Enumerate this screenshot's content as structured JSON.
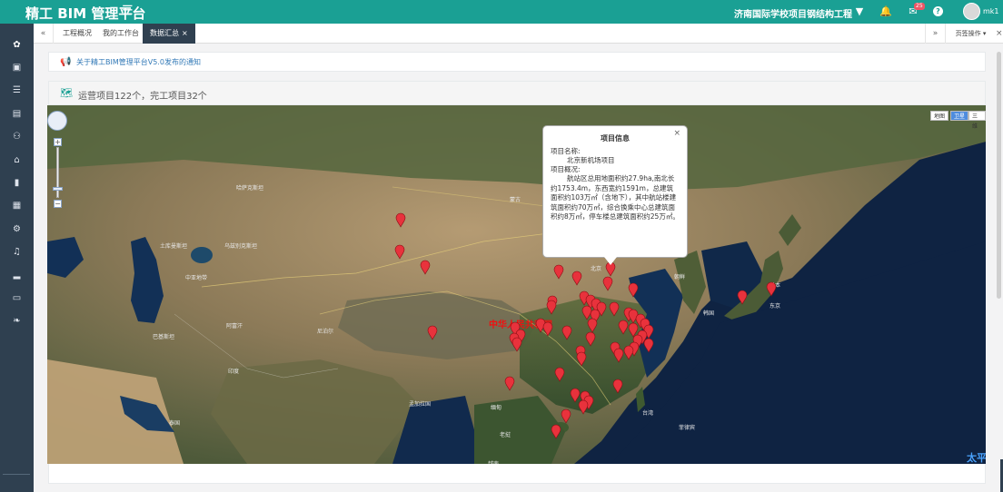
{
  "header": {
    "brand": "精工 BIM 管理平台",
    "menu_icon": "☰",
    "project_name": "济南国际学校项目钢结构工程",
    "icons": {
      "filter": "▼",
      "bell": "🔔",
      "mail": "✉",
      "help": "?"
    },
    "mail_badge": "25",
    "user_name": "mk1"
  },
  "sidebar": {
    "items": [
      {
        "icon": "✿",
        "name": "home"
      },
      {
        "icon": "▣",
        "name": "briefcase"
      },
      {
        "icon": "☰",
        "name": "sitemap"
      },
      {
        "icon": "▤",
        "name": "file"
      },
      {
        "icon": "⚇",
        "name": "people"
      },
      {
        "icon": "⌂",
        "name": "bank"
      },
      {
        "icon": "▮",
        "name": "book"
      },
      {
        "icon": "▦",
        "name": "money"
      },
      {
        "icon": "⚙",
        "name": "cogs"
      },
      {
        "icon": "♫",
        "name": "bell"
      },
      {
        "icon": "▂",
        "name": "signal"
      },
      {
        "icon": "▭",
        "name": "monitor"
      },
      {
        "icon": "❧",
        "name": "leaf"
      }
    ]
  },
  "tabs": {
    "prev_icon": "«",
    "items": [
      {
        "label": "工程概况",
        "active": false
      },
      {
        "label": "我的工作台",
        "active": false
      },
      {
        "label": "数据汇总",
        "active": true,
        "close": "×"
      }
    ],
    "next_icon": "»",
    "page_ops": "页签操作 ▾",
    "close_all_icon": "×"
  },
  "notice": {
    "icon": "📢",
    "text": "关于精工BIM管理平台V5.0发布的通知"
  },
  "panel": {
    "icon": "🗺",
    "summary": "运营项目122个，完工项目32个"
  },
  "map": {
    "types": [
      "地图",
      "卫星",
      "三维"
    ],
    "selected_type": "卫星",
    "zoom_in": "+",
    "zoom_out": "−",
    "labels": [
      {
        "text": "哈萨克斯坦",
        "name": "label-kazakhstan"
      },
      {
        "text": "蒙古",
        "name": "label-mongolia"
      },
      {
        "text": "乌兹别克斯坦",
        "name": "label-uzbekistan"
      },
      {
        "text": "土库曼斯坦",
        "name": "label-turkmenistan"
      },
      {
        "text": "中亚地带",
        "name": "label-central-asia"
      },
      {
        "text": "北京",
        "name": "label-beijing"
      },
      {
        "text": "朝鲜",
        "name": "label-north-korea"
      },
      {
        "text": "韩国",
        "name": "label-south-korea"
      },
      {
        "text": "日本",
        "name": "label-japan"
      },
      {
        "text": "东京",
        "name": "label-tokyo"
      },
      {
        "text": "阿富汗",
        "name": "label-afghanistan"
      },
      {
        "text": "巴基斯坦",
        "name": "label-pakistan"
      },
      {
        "text": "尼泊尔",
        "name": "label-nepal"
      },
      {
        "text": "中华人民共和国",
        "name": "label-china"
      },
      {
        "text": "印度",
        "name": "label-india"
      },
      {
        "text": "孟加拉国",
        "name": "label-bangladesh"
      },
      {
        "text": "缅甸",
        "name": "label-myanmar"
      },
      {
        "text": "老挝",
        "name": "label-laos"
      },
      {
        "text": "泰国",
        "name": "label-thailand"
      },
      {
        "text": "越南",
        "name": "label-vietnam"
      },
      {
        "text": "台湾",
        "name": "label-taiwan"
      },
      {
        "text": "菲律宾",
        "name": "label-philippines"
      },
      {
        "text": "太平",
        "name": "label-pacific"
      }
    ],
    "popup": {
      "title": "项目信息",
      "close": "×",
      "name_label": "项目名称:",
      "name_value": "北京新机场项目",
      "desc_label": "项目概况:",
      "desc_value": "航站区总用地面积约27.9ha,南北长约1753.4m，东西宽约1591m，总建筑面积约103万㎡（含地下），其中航站楼建筑面积约70万㎡，综合换乘中心总建筑面积约8万㎡，停车楼总建筑面积约25万㎡。"
    },
    "marker_color": "#e8323c"
  }
}
